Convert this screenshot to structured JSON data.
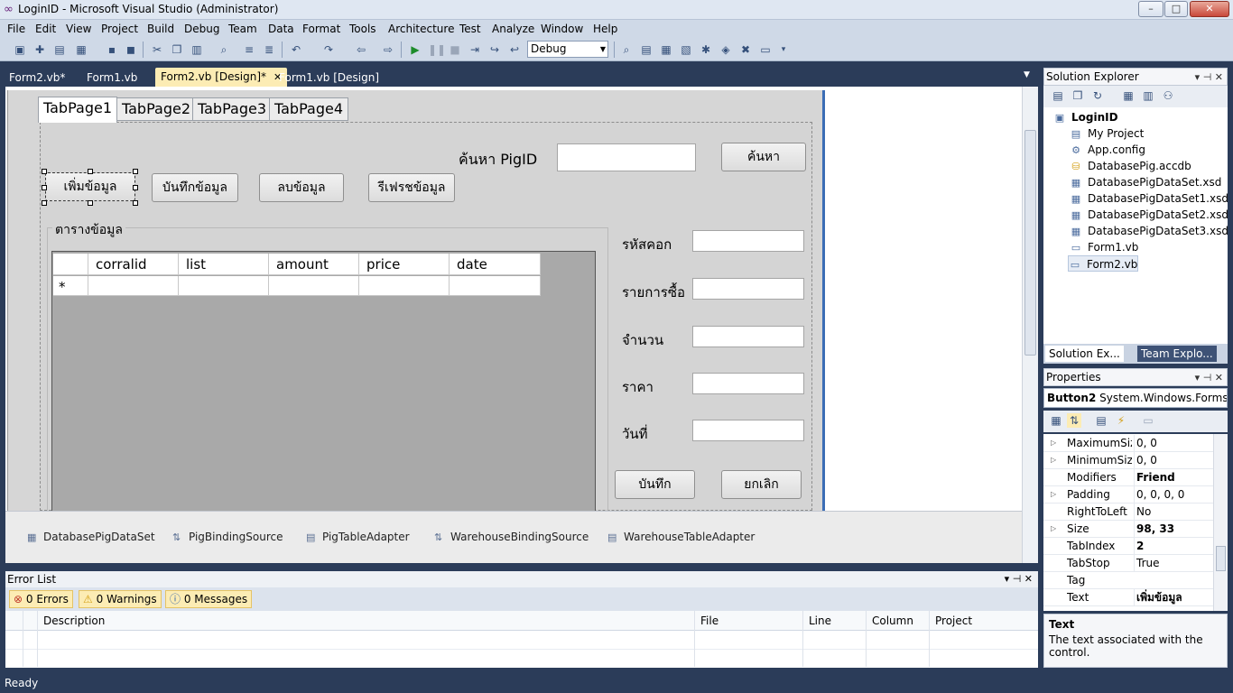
{
  "window": {
    "title": "LoginID - Microsoft Visual Studio (Administrator)",
    "controls": {
      "minimize": "–",
      "maximize": "□",
      "close": "✕"
    }
  },
  "menu": [
    "File",
    "Edit",
    "View",
    "Project",
    "Build",
    "Debug",
    "Team",
    "Data",
    "Format",
    "Tools",
    "Architecture",
    "Test",
    "Analyze",
    "Window",
    "Help"
  ],
  "toolbar": {
    "config": "Debug"
  },
  "doc_tabs": [
    {
      "label": "Form2.vb*"
    },
    {
      "label": "Form1.vb"
    },
    {
      "label": "Form2.vb [Design]*",
      "close": "✕"
    },
    {
      "label": "Form1.vb [Design]"
    }
  ],
  "form": {
    "tabs": [
      "TabPage1",
      "TabPage2",
      "TabPage3",
      "TabPage4"
    ],
    "search_label": "ค้นหา PigID",
    "search_button": "ค้นหา",
    "buttons": [
      "เพิ่มข้อมูล",
      "บันทึกข้อมูล",
      "ลบข้อมูล",
      "รีเฟรชข้อมูล"
    ],
    "groupbox_title": "ตารางข้อมูล",
    "grid": {
      "columns": [
        "corralid",
        "list",
        "amount",
        "price",
        "date"
      ],
      "new_row_marker": "*"
    },
    "fields": [
      "รหัสคอก",
      "รายการซื้อ",
      "จำนวน",
      "ราคา",
      "วันที่"
    ],
    "save_button": "บันทึก",
    "cancel_button": "ยกเลิก"
  },
  "tray": [
    "DatabasePigDataSet",
    "PigBindingSource",
    "PigTableAdapter",
    "WarehouseBindingSource",
    "WarehouseTableAdapter"
  ],
  "error_list": {
    "title": "Error List",
    "errors": "0 Errors",
    "warnings": "0 Warnings",
    "messages": "0 Messages",
    "columns": [
      "Description",
      "File",
      "Line",
      "Column",
      "Project"
    ]
  },
  "status": "Ready",
  "solution_explorer": {
    "title": "Solution Explorer",
    "root": "LoginID",
    "items": [
      "My Project",
      "App.config",
      "DatabasePig.accdb",
      "DatabasePigDataSet.xsd",
      "DatabasePigDataSet1.xsd",
      "DatabasePigDataSet2.xsd",
      "DatabasePigDataSet3.xsd",
      "Form1.vb",
      "Form2.vb"
    ],
    "tabs": [
      "Solution Ex...",
      "Team Explo..."
    ]
  },
  "properties": {
    "title": "Properties",
    "object_name": "Button2",
    "object_type": "System.Windows.Forms.B",
    "rows": [
      {
        "name": "MaximumSize",
        "value": "0, 0",
        "expand": "▷"
      },
      {
        "name": "MinimumSize",
        "value": "0, 0",
        "expand": "▷"
      },
      {
        "name": "Modifiers",
        "value": "Friend",
        "expand": ""
      },
      {
        "name": "Padding",
        "value": "0, 0, 0, 0",
        "expand": "▷"
      },
      {
        "name": "RightToLeft",
        "value": "No",
        "expand": ""
      },
      {
        "name": "Size",
        "value": "98, 33",
        "expand": "▷"
      },
      {
        "name": "TabIndex",
        "value": "2",
        "expand": ""
      },
      {
        "name": "TabStop",
        "value": "True",
        "expand": ""
      },
      {
        "name": "Tag",
        "value": "",
        "expand": ""
      },
      {
        "name": "Text",
        "value": "เพิ่มข้อมูล",
        "expand": ""
      }
    ],
    "desc_title": "Text",
    "desc_text": "The text associated with the control."
  }
}
